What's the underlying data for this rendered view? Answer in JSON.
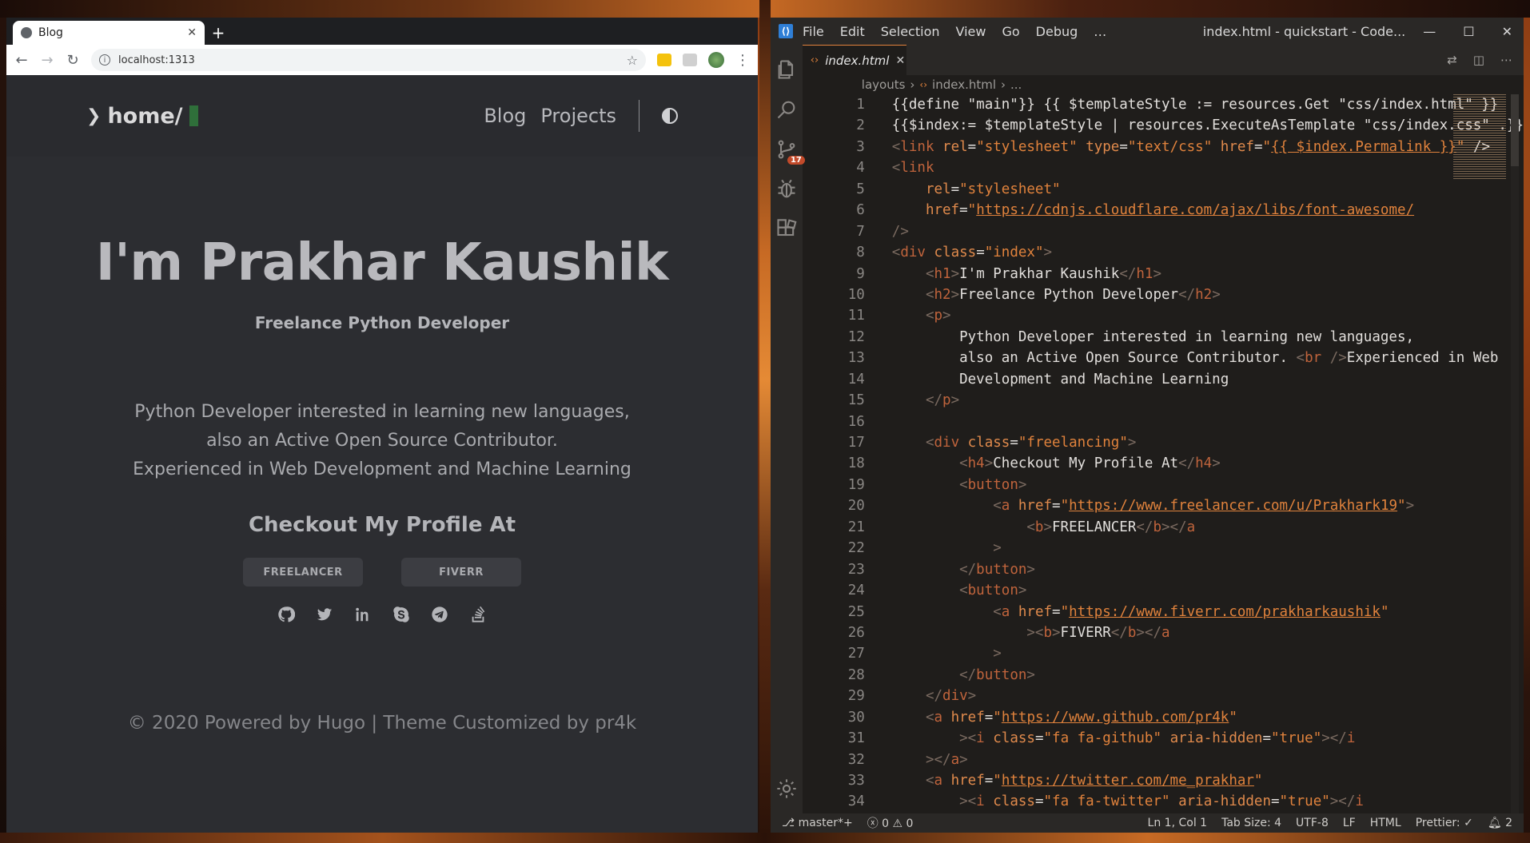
{
  "browser": {
    "tab_title": "Blog",
    "url": "localhost:1313",
    "site": {
      "logo": "home/",
      "nav": [
        "Blog",
        "Projects"
      ],
      "heading": "I'm Prakhar Kaushik",
      "subheading": "Freelance Python Developer",
      "bio_lines": [
        "Python Developer interested in learning new languages,",
        "also an Active Open Source Contributor.",
        "Experienced in Web Development and Machine Learning"
      ],
      "profile_heading": "Checkout My Profile At",
      "buttons": [
        "FREELANCER",
        "FIVERR"
      ],
      "social_icons": [
        "github-icon",
        "twitter-icon",
        "linkedin-icon",
        "skype-icon",
        "telegram-icon",
        "stackoverflow-icon"
      ],
      "footer": "© 2020 Powered by Hugo | Theme Customized by pr4k"
    }
  },
  "vscode": {
    "menu": [
      "File",
      "Edit",
      "Selection",
      "View",
      "Go",
      "Debug",
      "…"
    ],
    "window_title": "index.html - quickstart - Code...",
    "scm_badge": "17",
    "tab": "index.html",
    "breadcrumb": [
      "layouts",
      "index.html",
      "..."
    ],
    "line_numbers": [
      "1",
      "2",
      "3",
      "4",
      "5",
      "6",
      "7",
      "8",
      "9",
      "10",
      "11",
      "12",
      "13",
      "14",
      "15",
      "16",
      "17",
      "18",
      "19",
      "20",
      "21",
      "22",
      "23",
      "24",
      "25",
      "26",
      "27",
      "28",
      "29",
      "30",
      "31",
      "32",
      "33",
      "34"
    ],
    "status": {
      "branch": "master*+",
      "errors": "0",
      "warnings": "0",
      "position": "Ln 1, Col 1",
      "tab_size": "Tab Size: 4",
      "encoding": "UTF-8",
      "eol": "LF",
      "language": "HTML",
      "prettier": "Prettier: ✓",
      "notifications": "2"
    },
    "accent": "#e0823c"
  }
}
